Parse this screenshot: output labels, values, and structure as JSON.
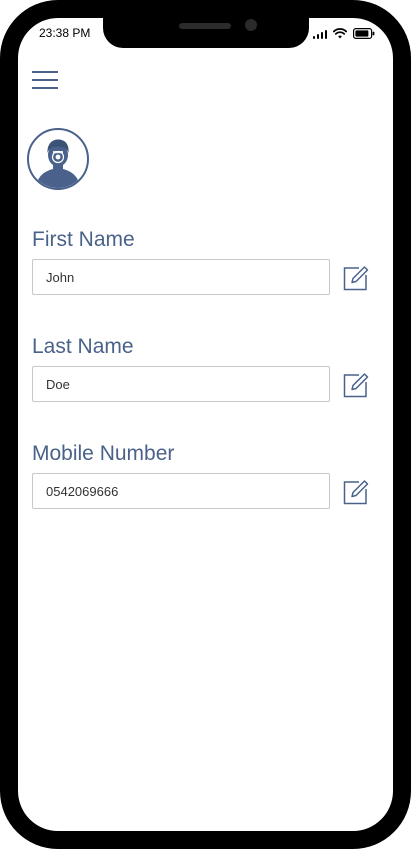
{
  "status_bar": {
    "time": "23:38 PM"
  },
  "menu": {
    "icon": "hamburger-menu-icon"
  },
  "profile": {
    "avatar_icon": "user-avatar-icon"
  },
  "fields": [
    {
      "label": "First Name",
      "value": "John"
    },
    {
      "label": "Last Name",
      "value": "Doe"
    },
    {
      "label": "Mobile Number",
      "value": "0542069666"
    }
  ],
  "colors": {
    "accent": "#4a628b",
    "label": "#4a6289",
    "input_border": "#c8c8c8",
    "frame": "#000000"
  },
  "icons": {
    "edit": "edit-pencil-icon"
  }
}
